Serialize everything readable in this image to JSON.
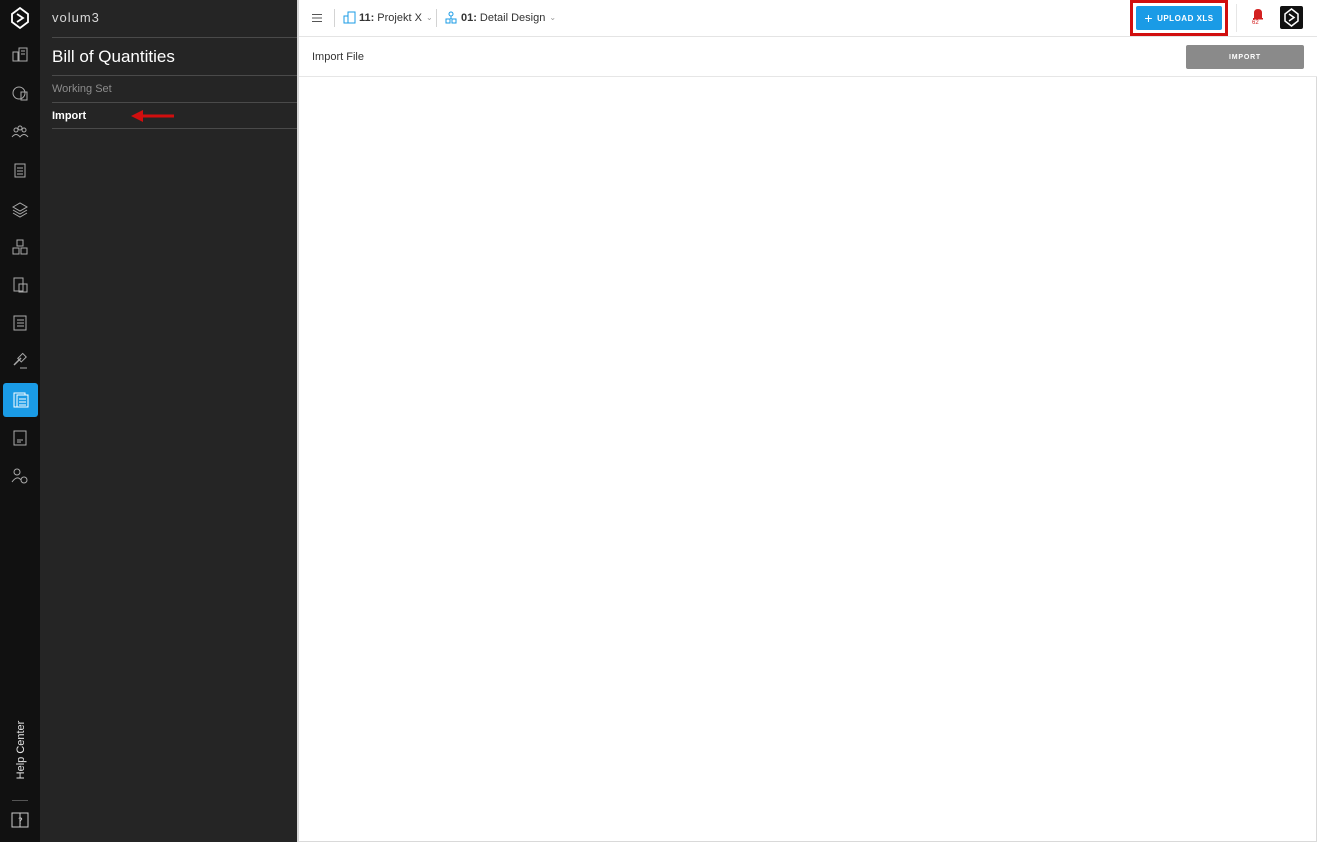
{
  "app": {
    "brand": "volum3",
    "icons": [
      "logo-icon",
      "buildings-icon",
      "globe-building-icon",
      "team-icon",
      "clipboard-icon",
      "layers-icon",
      "cubes-icon",
      "document-transfer-icon",
      "bill-of-quantities-icon",
      "tender-hammer-icon",
      "bill-of-quantities-active-icon",
      "invoice-icon",
      "user-settings-icon"
    ]
  },
  "panel": {
    "title": "Bill of Quantities",
    "items": [
      {
        "label": "Working Set"
      },
      {
        "label": "Import"
      }
    ]
  },
  "help_center": {
    "label": "Help Center"
  },
  "topbar": {
    "project": {
      "number": "11:",
      "name": "Projekt X"
    },
    "phase": {
      "number": "01:",
      "name": "Detail Design"
    },
    "upload_label": "UPLOAD XLS",
    "notification_count": "62"
  },
  "subbar": {
    "title": "Import File",
    "import_label": "IMPORT"
  },
  "colors": {
    "accent": "#1a9be6",
    "highlight": "#d10e0e",
    "rail": "#111111",
    "panel": "#252525"
  }
}
